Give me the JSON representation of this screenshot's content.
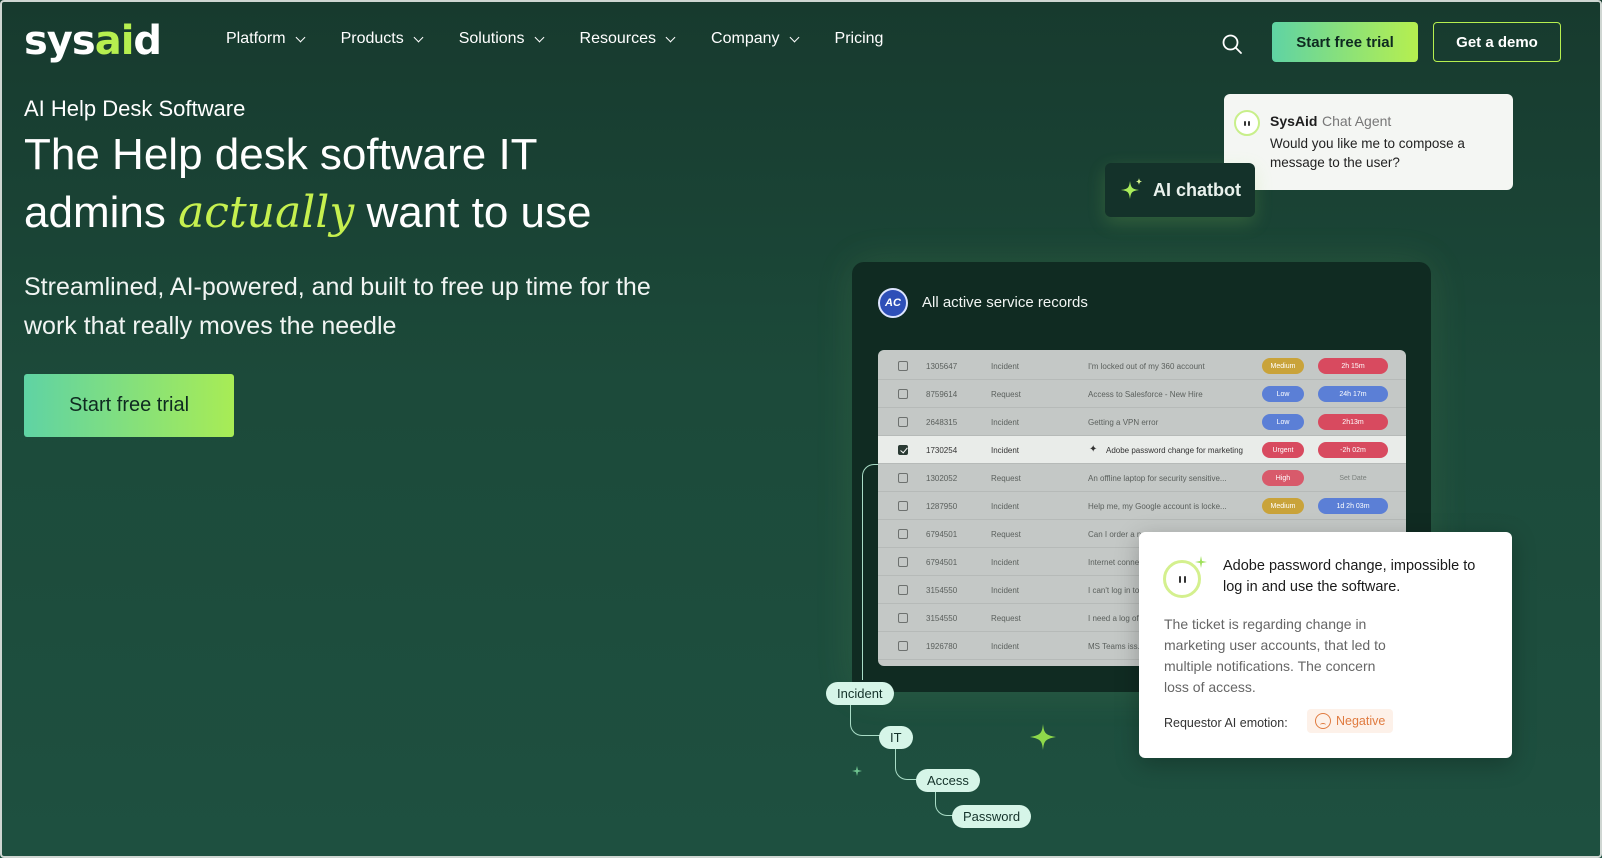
{
  "nav": {
    "logo_prefix": "sys",
    "logo_accent": "ai",
    "logo_suffix": "d",
    "menu": [
      "Platform",
      "Products",
      "Solutions",
      "Resources",
      "Company",
      "Pricing"
    ],
    "cta_trial": "Start free trial",
    "cta_demo": "Get a demo"
  },
  "hero": {
    "eyebrow": "AI Help Desk Software",
    "headline_line1": "The Help desk software IT",
    "headline_pre": "admins ",
    "headline_accent": "actually",
    "headline_post": " want to use",
    "subhead": "Streamlined, AI-powered, and built to free up time for the work that really moves the needle",
    "cta": "Start free trial"
  },
  "chat": {
    "name": "SysAid",
    "role": "Chat Agent",
    "message": "Would you like me to compose a message to the user?"
  },
  "ai_chip": {
    "label": "AI chatbot"
  },
  "panel": {
    "avatar": "AC",
    "title": "All active service records",
    "rows": [
      {
        "id": "1305647",
        "type": "Incident",
        "subject": "I'm locked out of my 360 account",
        "priority": "Medium",
        "sla": "2h 15m"
      },
      {
        "id": "8759614",
        "type": "Request",
        "subject": "Access to Salesforce - New Hire",
        "priority": "Low",
        "sla": "24h 17m"
      },
      {
        "id": "2648315",
        "type": "Incident",
        "subject": "Getting a VPN error",
        "priority": "Low",
        "sla": "2h13m"
      },
      {
        "id": "1730254",
        "type": "Incident",
        "subject": "Adobe password change for marketing",
        "priority": "Urgent",
        "sla": "-2h 02m"
      },
      {
        "id": "1302052",
        "type": "Request",
        "subject": "An offline laptop for security sensitive...",
        "priority": "High",
        "sla": "Set Date"
      },
      {
        "id": "1287950",
        "type": "Incident",
        "subject": "Help me, my Google account is locke...",
        "priority": "Medium",
        "sla": "1d 2h 03m"
      },
      {
        "id": "6794501",
        "type": "Request",
        "subject": "Can I order a n...",
        "priority": "",
        "sla": ""
      },
      {
        "id": "6794501",
        "type": "Incident",
        "subject": "Internet conne...",
        "priority": "",
        "sla": ""
      },
      {
        "id": "3154550",
        "type": "Incident",
        "subject": "I can't log in to...",
        "priority": "",
        "sla": ""
      },
      {
        "id": "3154550",
        "type": "Request",
        "subject": "I need a log of...",
        "priority": "",
        "sla": ""
      },
      {
        "id": "1926780",
        "type": "Incident",
        "subject": "MS Teams iss...",
        "priority": "",
        "sla": ""
      }
    ]
  },
  "tags": [
    "Incident",
    "IT",
    "Access",
    "Password"
  ],
  "insight": {
    "title": "Adobe password change, impossible to log in and use the software.",
    "body": "The ticket is regarding change in marketing user accounts, that led to multiple notifications. The concern loss of access.",
    "emotion_label": "Requestor AI emotion:",
    "emotion_value": "Negative"
  },
  "colors": {
    "accent_lime": "#b6ef4f",
    "accent_green": "#5fd3a4",
    "bg": "#1c4a3a",
    "priority_medium": "#c9a33a",
    "priority_low": "#5b7fd6",
    "priority_urgent": "#d84a5f",
    "priority_high": "#d85a6b",
    "negative": "#e07b40"
  },
  "icons": [
    "search-icon",
    "chevron-down-icon",
    "sparkle-icon",
    "cursor-icon",
    "sad-face-icon"
  ]
}
